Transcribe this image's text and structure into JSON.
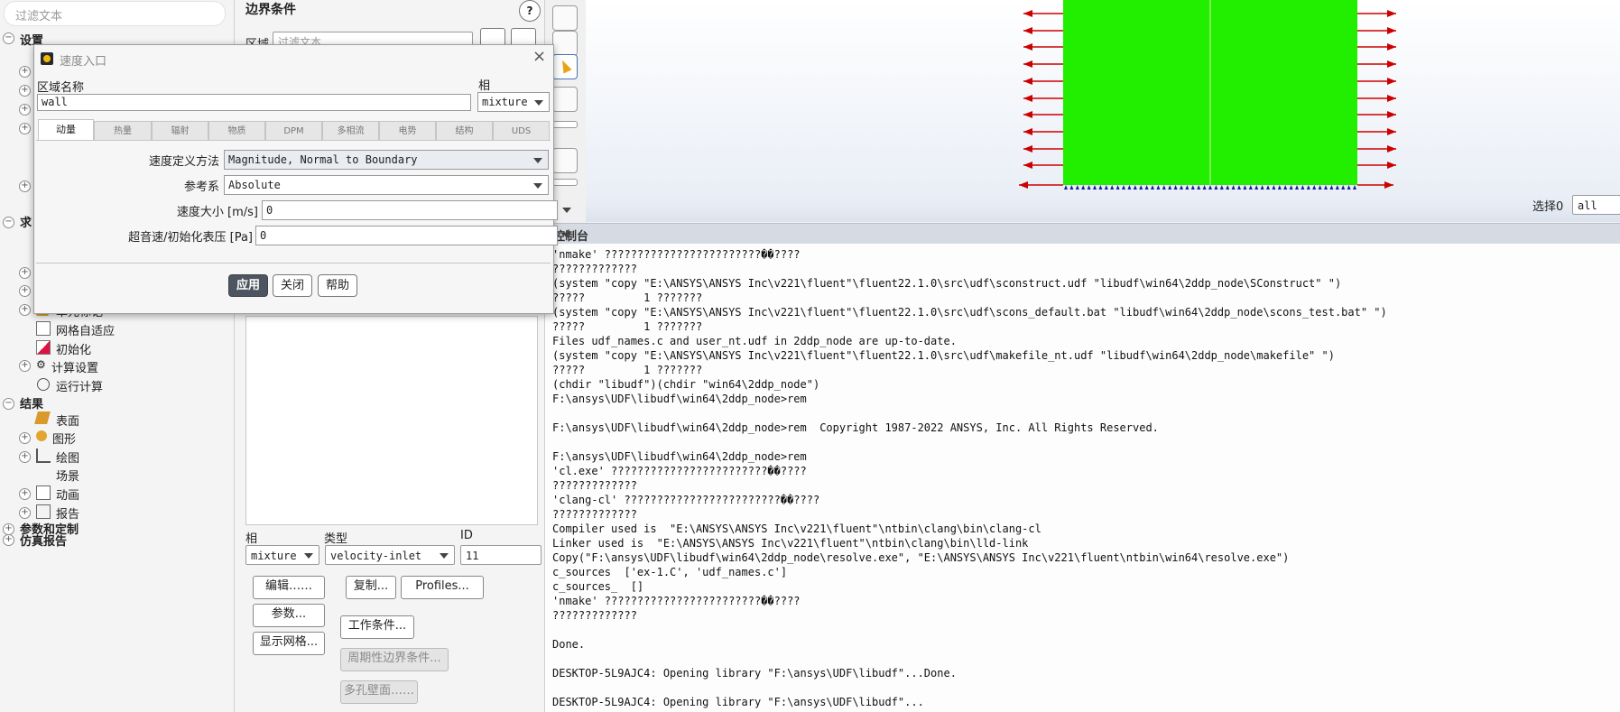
{
  "tree": {
    "filter_placeholder": "过滤文本",
    "section_setup": "设置",
    "section_solve": "求",
    "item_cell_marking": "单元标记",
    "item_mesh_adapt": "网格自适应",
    "item_init": "初始化",
    "item_calc_settings": "计算设置",
    "item_run_calc": "运行计算",
    "section_results": "结果",
    "item_surface": "表面",
    "item_graphics": "图形",
    "item_plots": "绘图",
    "item_scene": "场景",
    "item_animation": "动画",
    "item_reports": "报告",
    "section_params": "参数和定制",
    "section_sim_reports": "仿真报告"
  },
  "bc_panel": {
    "title": "边界条件",
    "zone_label": "区域",
    "zone_filter_placeholder": "过滤文本",
    "phase_label": "相",
    "type_label": "类型",
    "id_label": "ID",
    "phase_value": "mixture",
    "type_value": "velocity-inlet",
    "id_value": "11",
    "edit_btn": "编辑……",
    "copy_btn": "复制...",
    "profiles_btn": "Profiles...",
    "params_btn": "参数...",
    "operating_btn": "工作条件...",
    "display_mesh_btn": "显示网格...",
    "periodic_btn": "周期性边界条件...",
    "porous_btn": "多孔壁面……",
    "help_icon_text": "?"
  },
  "graphics": {
    "select_label": "选择0",
    "select_value": "all"
  },
  "console": {
    "title": "控制台",
    "lines": [
      "'nmake' ????????????????????????��????",
      "?????????????",
      "(system \"copy \"E:\\ANSYS\\ANSYS Inc\\v221\\fluent\"\\fluent22.1.0\\src\\udf\\sconstruct.udf \"libudf\\win64\\2ddp_node\\SConstruct\" \")",
      "?????         1 ???????",
      "(system \"copy \"E:\\ANSYS\\ANSYS Inc\\v221\\fluent\"\\fluent22.1.0\\src\\udf\\scons_default.bat \"libudf\\win64\\2ddp_node\\scons_test.bat\" \")",
      "?????         1 ???????",
      "Files udf_names.c and user_nt.udf in 2ddp_node are up-to-date.",
      "(system \"copy \"E:\\ANSYS\\ANSYS Inc\\v221\\fluent\"\\fluent22.1.0\\src\\udf\\makefile_nt.udf \"libudf\\win64\\2ddp_node\\makefile\" \")",
      "?????         1 ???????",
      "(chdir \"libudf\")(chdir \"win64\\2ddp_node\")",
      "F:\\ansys\\UDF\\libudf\\win64\\2ddp_node>rem",
      "",
      "F:\\ansys\\UDF\\libudf\\win64\\2ddp_node>rem  Copyright 1987-2022 ANSYS, Inc. All Rights Reserved.",
      "",
      "F:\\ansys\\UDF\\libudf\\win64\\2ddp_node>rem",
      "'cl.exe' ????????????????????????��????",
      "?????????????",
      "'clang-cl' ????????????????????????��????",
      "?????????????",
      "Compiler used is  \"E:\\ANSYS\\ANSYS Inc\\v221\\fluent\"\\ntbin\\clang\\bin\\clang-cl",
      "Linker used is  \"E:\\ANSYS\\ANSYS Inc\\v221\\fluent\"\\ntbin\\clang\\bin\\lld-link",
      "Copy(\"F:\\ansys\\UDF\\libudf\\win64\\2ddp_node\\resolve.exe\", \"E:\\ANSYS\\ANSYS Inc\\v221\\fluent\\ntbin\\win64\\resolve.exe\")",
      "c_sources  ['ex-1.C', 'udf_names.c']",
      "c_sources_  []",
      "'nmake' ????????????????????????��????",
      "?????????????",
      "",
      "Done.",
      "",
      "DESKTOP-5L9AJC4: Opening library \"F:\\ansys\\UDF\\libudf\"...Done.",
      "",
      "DESKTOP-5L9AJC4: Opening library \"F:\\ansys\\UDF\\libudf\"..."
    ]
  },
  "dialog": {
    "title": "速度入口",
    "zone_name_label": "区域名称",
    "zone_name_value": "wall",
    "phase_label": "相",
    "phase_value": "mixture",
    "tabs": [
      "动量",
      "热量",
      "辐射",
      "物质",
      "DPM",
      "多相流",
      "电势",
      "结构",
      "UDS"
    ],
    "velocity_method_label": "速度定义方法",
    "velocity_method_value": "Magnitude, Normal to Boundary",
    "reference_frame_label": "参考系",
    "reference_frame_value": "Absolute",
    "velocity_magnitude_label": "速度大小 [m/s]",
    "velocity_magnitude_value": "0",
    "gauge_pressure_label": "超音速/初始化表压 [Pa]",
    "gauge_pressure_value": "0",
    "apply_btn": "应用",
    "close_btn": "关闭",
    "help_btn": "帮助"
  },
  "colors": {
    "domain_fill": "#22ee00",
    "arrow_color": "#cc0000",
    "marker_color": "#1a1aa0",
    "primary_button": "#4d5560"
  }
}
